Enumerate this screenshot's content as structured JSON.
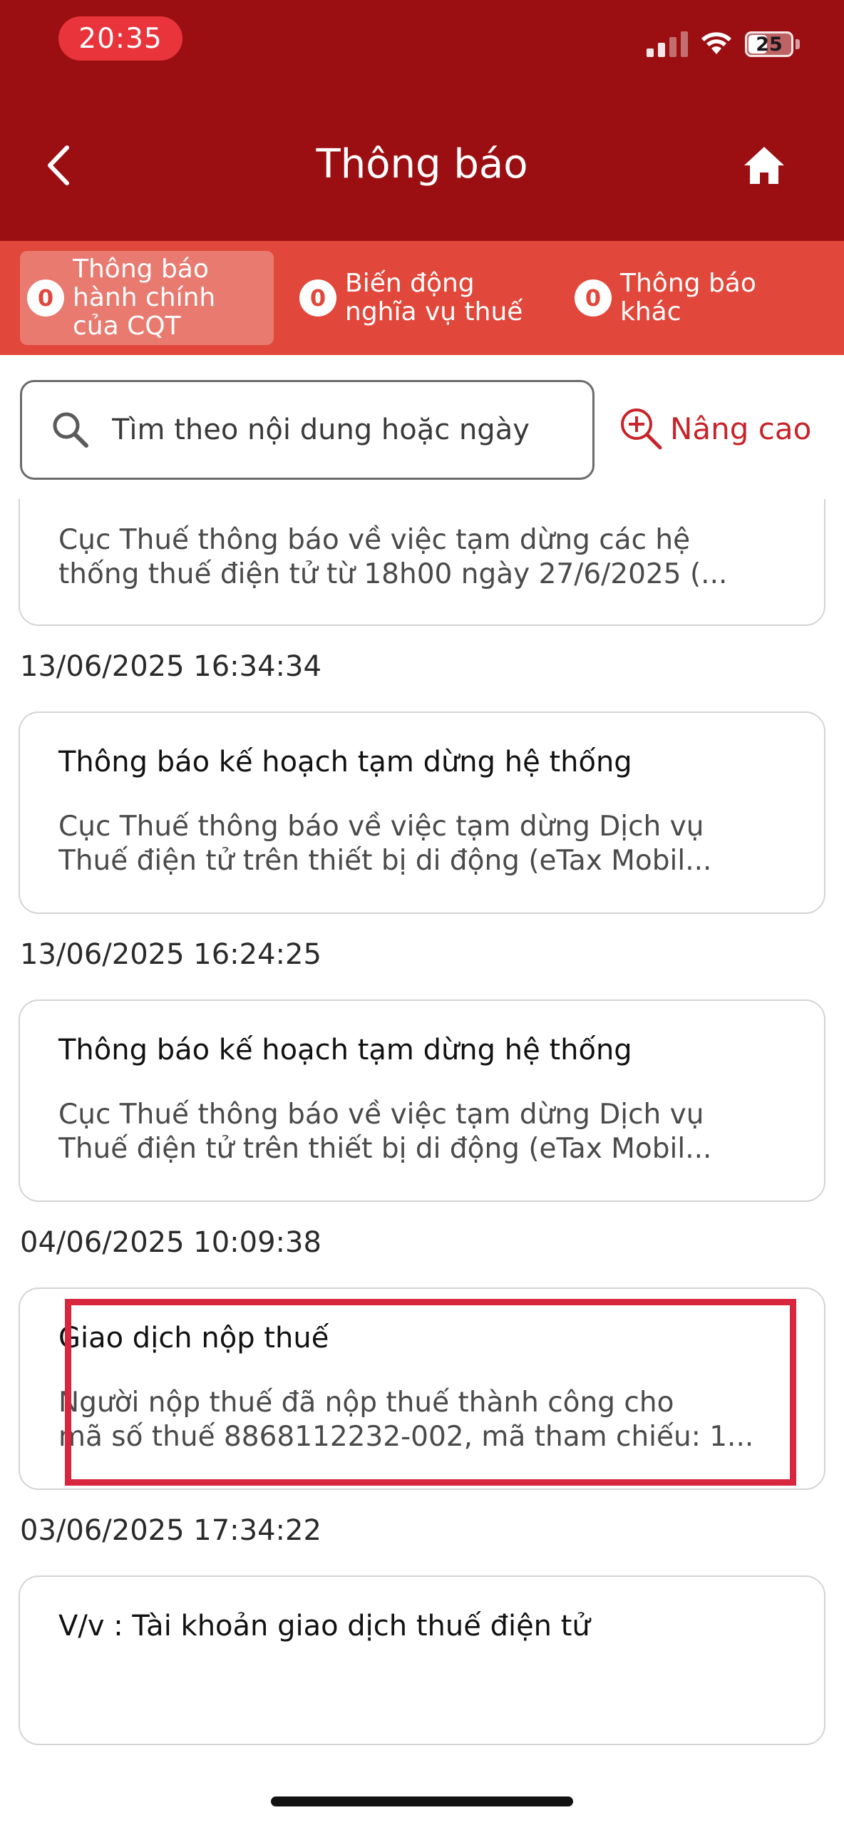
{
  "status_bar": {
    "time": "20:35",
    "battery": "25"
  },
  "header": {
    "title": "Thông báo"
  },
  "tabs": [
    {
      "count": "0",
      "line1": "Thông báo",
      "line2": "hành chính",
      "line3": "của CQT",
      "active": true
    },
    {
      "count": "0",
      "line1": "Biến động",
      "line2": "nghĩa vụ thuế"
    },
    {
      "count": "0",
      "line1": "Thông báo",
      "line2": "khác"
    }
  ],
  "search": {
    "placeholder": "Tìm theo nội dung hoặc ngày",
    "advanced_label": "Nâng cao"
  },
  "notifications": [
    {
      "date": "",
      "title": "",
      "line1": "Cục Thuế thông báo về việc tạm dừng các hệ",
      "line2": "thống thuế điện tử từ 18h00 ngày 27/6/2025 (..."
    },
    {
      "date": "13/06/2025 16:34:34",
      "title": "Thông báo kế hoạch tạm dừng hệ thống",
      "line1": "Cục Thuế thông báo về việc tạm dừng Dịch vụ",
      "line2": "Thuế điện tử trên thiết bị di động (eTax Mobil..."
    },
    {
      "date": "13/06/2025 16:24:25",
      "title": "Thông báo kế hoạch tạm dừng hệ thống",
      "line1": "Cục Thuế thông báo về việc tạm dừng Dịch vụ",
      "line2": "Thuế điện tử trên thiết bị di động (eTax Mobil..."
    },
    {
      "date": "04/06/2025 10:09:38",
      "title": "Giao dịch nộp thuế",
      "line1": "Người nộp thuế đã nộp thuế thành công cho",
      "line2": "mã số thuế 8868112232-002, mã tham chiếu: 1..."
    },
    {
      "date": "03/06/2025 17:34:22",
      "title": "V/v : Tài khoản giao dịch thuế điện tử",
      "line1": "",
      "line2": ""
    }
  ],
  "colors": {
    "header": "#9b0f12",
    "tabs": "#e1473a",
    "accent": "#c8232a",
    "highlight": "#d7263d"
  }
}
